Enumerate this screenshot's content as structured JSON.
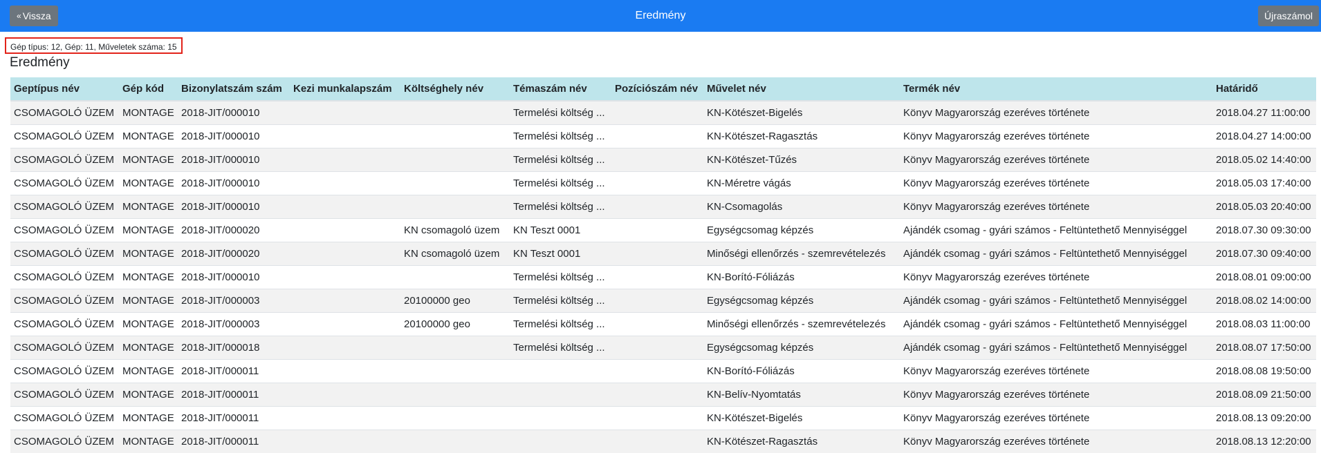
{
  "header": {
    "back_label": "Vissza",
    "title": "Eredmény",
    "recalc_label": "Újraszámol"
  },
  "info": "Gép típus: 12, Gép: 11, Műveletek száma: 15",
  "heading": "Eredmény",
  "table": {
    "columns": [
      "Geptípus név",
      "Gép kód",
      "Bizonylatszám szám",
      "Kezi munkalapszám",
      "Költséghely név",
      "Témaszám név",
      "Pozíciószám név",
      "Művelet név",
      "Termék név",
      "Határidő"
    ],
    "rows": [
      [
        "CSOMAGOLÓ ÜZEM",
        "MONTAGE",
        "2018-JIT/000010",
        "",
        "",
        "Termelési költség ...",
        "",
        "KN-Kötészet-Bigelés",
        "Könyv Magyarország ezeréves története",
        "2018.04.27 11:00:00"
      ],
      [
        "CSOMAGOLÓ ÜZEM",
        "MONTAGE",
        "2018-JIT/000010",
        "",
        "",
        "Termelési költség ...",
        "",
        "KN-Kötészet-Ragasztás",
        "Könyv Magyarország ezeréves története",
        "2018.04.27 14:00:00"
      ],
      [
        "CSOMAGOLÓ ÜZEM",
        "MONTAGE",
        "2018-JIT/000010",
        "",
        "",
        "Termelési költség ...",
        "",
        "KN-Kötészet-Tűzés",
        "Könyv Magyarország ezeréves története",
        "2018.05.02 14:40:00"
      ],
      [
        "CSOMAGOLÓ ÜZEM",
        "MONTAGE",
        "2018-JIT/000010",
        "",
        "",
        "Termelési költség ...",
        "",
        "KN-Méretre vágás",
        "Könyv Magyarország ezeréves története",
        "2018.05.03 17:40:00"
      ],
      [
        "CSOMAGOLÓ ÜZEM",
        "MONTAGE",
        "2018-JIT/000010",
        "",
        "",
        "Termelési költség ...",
        "",
        "KN-Csomagolás",
        "Könyv Magyarország ezeréves története",
        "2018.05.03 20:40:00"
      ],
      [
        "CSOMAGOLÓ ÜZEM",
        "MONTAGE",
        "2018-JIT/000020",
        "",
        "KN csomagoló üzem",
        "KN Teszt 0001",
        "",
        "Egységcsomag képzés",
        "Ajándék csomag - gyári számos - Feltüntethető Mennyiséggel",
        "2018.07.30 09:30:00"
      ],
      [
        "CSOMAGOLÓ ÜZEM",
        "MONTAGE",
        "2018-JIT/000020",
        "",
        "KN csomagoló üzem",
        "KN Teszt 0001",
        "",
        "Minőségi ellenőrzés - szemrevételezés",
        "Ajándék csomag - gyári számos - Feltüntethető Mennyiséggel",
        "2018.07.30 09:40:00"
      ],
      [
        "CSOMAGOLÓ ÜZEM",
        "MONTAGE",
        "2018-JIT/000010",
        "",
        "",
        "Termelési költség ...",
        "",
        "KN-Borító-Fóliázás",
        "Könyv Magyarország ezeréves története",
        "2018.08.01 09:00:00"
      ],
      [
        "CSOMAGOLÓ ÜZEM",
        "MONTAGE",
        "2018-JIT/000003",
        "",
        "20100000 geo",
        "Termelési költség ...",
        "",
        "Egységcsomag képzés",
        "Ajándék csomag - gyári számos - Feltüntethető Mennyiséggel",
        "2018.08.02 14:00:00"
      ],
      [
        "CSOMAGOLÓ ÜZEM",
        "MONTAGE",
        "2018-JIT/000003",
        "",
        "20100000 geo",
        "Termelési költség ...",
        "",
        "Minőségi ellenőrzés - szemrevételezés",
        "Ajándék csomag - gyári számos - Feltüntethető Mennyiséggel",
        "2018.08.03 11:00:00"
      ],
      [
        "CSOMAGOLÓ ÜZEM",
        "MONTAGE",
        "2018-JIT/000018",
        "",
        "",
        "Termelési költség ...",
        "",
        "Egységcsomag képzés",
        "Ajándék csomag - gyári számos - Feltüntethető Mennyiséggel",
        "2018.08.07 17:50:00"
      ],
      [
        "CSOMAGOLÓ ÜZEM",
        "MONTAGE",
        "2018-JIT/000011",
        "",
        "",
        "",
        "",
        "KN-Borító-Fóliázás",
        "Könyv Magyarország ezeréves története",
        "2018.08.08 19:50:00"
      ],
      [
        "CSOMAGOLÓ ÜZEM",
        "MONTAGE",
        "2018-JIT/000011",
        "",
        "",
        "",
        "",
        "KN-Belív-Nyomtatás",
        "Könyv Magyarország ezeréves története",
        "2018.08.09 21:50:00"
      ],
      [
        "CSOMAGOLÓ ÜZEM",
        "MONTAGE",
        "2018-JIT/000011",
        "",
        "",
        "",
        "",
        "KN-Kötészet-Bigelés",
        "Könyv Magyarország ezeréves története",
        "2018.08.13 09:20:00"
      ],
      [
        "CSOMAGOLÓ ÜZEM",
        "MONTAGE",
        "2018-JIT/000011",
        "",
        "",
        "",
        "",
        "KN-Kötészet-Ragasztás",
        "Könyv Magyarország ezeréves története",
        "2018.08.13 12:20:00"
      ]
    ]
  }
}
